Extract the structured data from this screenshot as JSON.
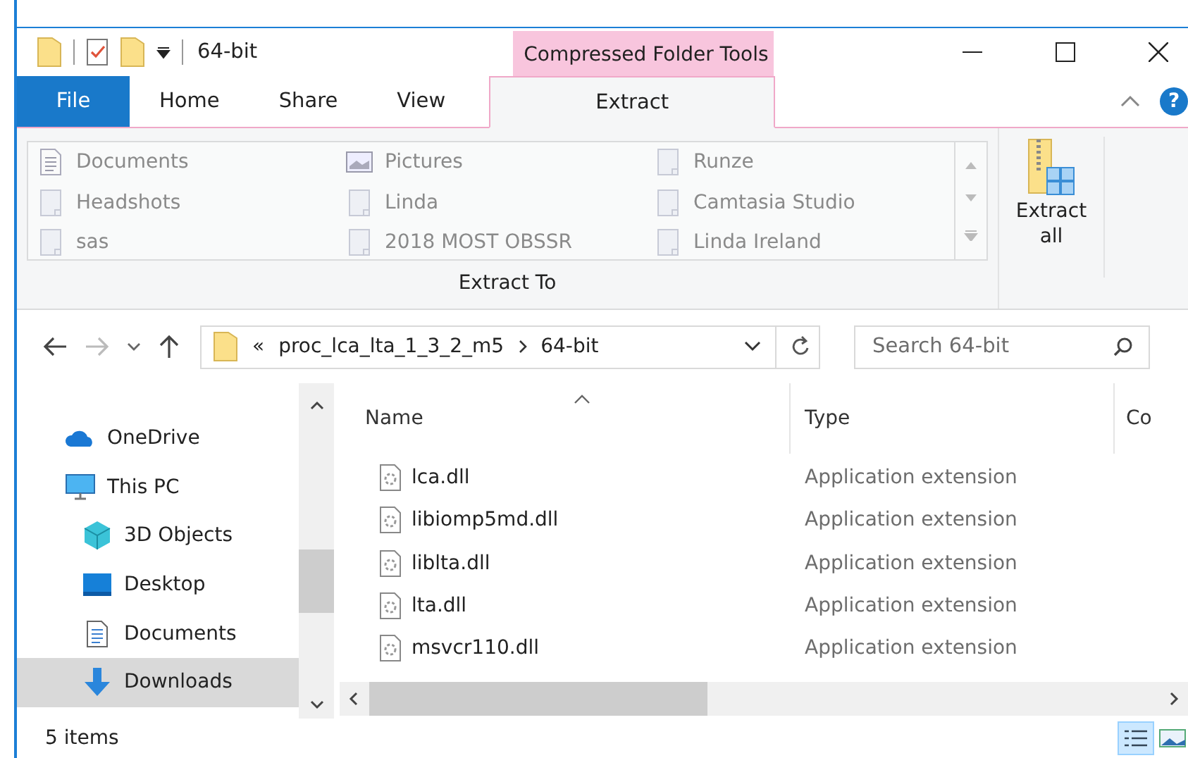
{
  "window": {
    "title": "64-bit",
    "context_tab_group": "Compressed Folder Tools",
    "help": "?"
  },
  "ribbon_tabs": [
    {
      "label": "File",
      "kind": "file",
      "selected": false
    },
    {
      "label": "Home",
      "kind": "tab",
      "selected": false
    },
    {
      "label": "Share",
      "kind": "tab",
      "selected": false
    },
    {
      "label": "View",
      "kind": "tab",
      "selected": false
    },
    {
      "label": "Extract",
      "kind": "context",
      "selected": true
    }
  ],
  "extract_to": {
    "group_label": "Extract To",
    "items": [
      {
        "label": "Documents",
        "kind": "documents"
      },
      {
        "label": "Pictures",
        "kind": "pictures"
      },
      {
        "label": "Runze",
        "kind": "folder"
      },
      {
        "label": "Headshots",
        "kind": "folder"
      },
      {
        "label": "Linda",
        "kind": "folder"
      },
      {
        "label": "Camtasia Studio",
        "kind": "folder"
      },
      {
        "label": "sas",
        "kind": "folder"
      },
      {
        "label": "2018 MOST OBSSR",
        "kind": "folder"
      },
      {
        "label": "Linda Ireland",
        "kind": "folder"
      }
    ],
    "extract_all": "Extract\nall"
  },
  "address_bar": {
    "overflow": "«",
    "path": [
      "proc_lca_lta_1_3_2_m5",
      "64-bit"
    ]
  },
  "search": {
    "placeholder": "Search 64-bit"
  },
  "nav_pane": [
    {
      "label": "OneDrive",
      "kind": "onedrive",
      "selected": false
    },
    {
      "label": "This PC",
      "kind": "pc",
      "selected": false,
      "children": [
        {
          "label": "3D Objects",
          "kind": "objects3d",
          "selected": false
        },
        {
          "label": "Desktop",
          "kind": "desktop",
          "selected": false
        },
        {
          "label": "Documents",
          "kind": "documents",
          "selected": false
        },
        {
          "label": "Downloads",
          "kind": "downloads",
          "selected": true
        }
      ]
    }
  ],
  "file_list": {
    "columns": [
      "Name",
      "Type",
      "Co"
    ],
    "rows": [
      {
        "name": "lca.dll",
        "type": "Application extension"
      },
      {
        "name": "libiomp5md.dll",
        "type": "Application extension"
      },
      {
        "name": "liblta.dll",
        "type": "Application extension"
      },
      {
        "name": "lta.dll",
        "type": "Application extension"
      },
      {
        "name": "msvcr110.dll",
        "type": "Application extension"
      }
    ]
  },
  "status_bar": {
    "count": "5 items"
  }
}
